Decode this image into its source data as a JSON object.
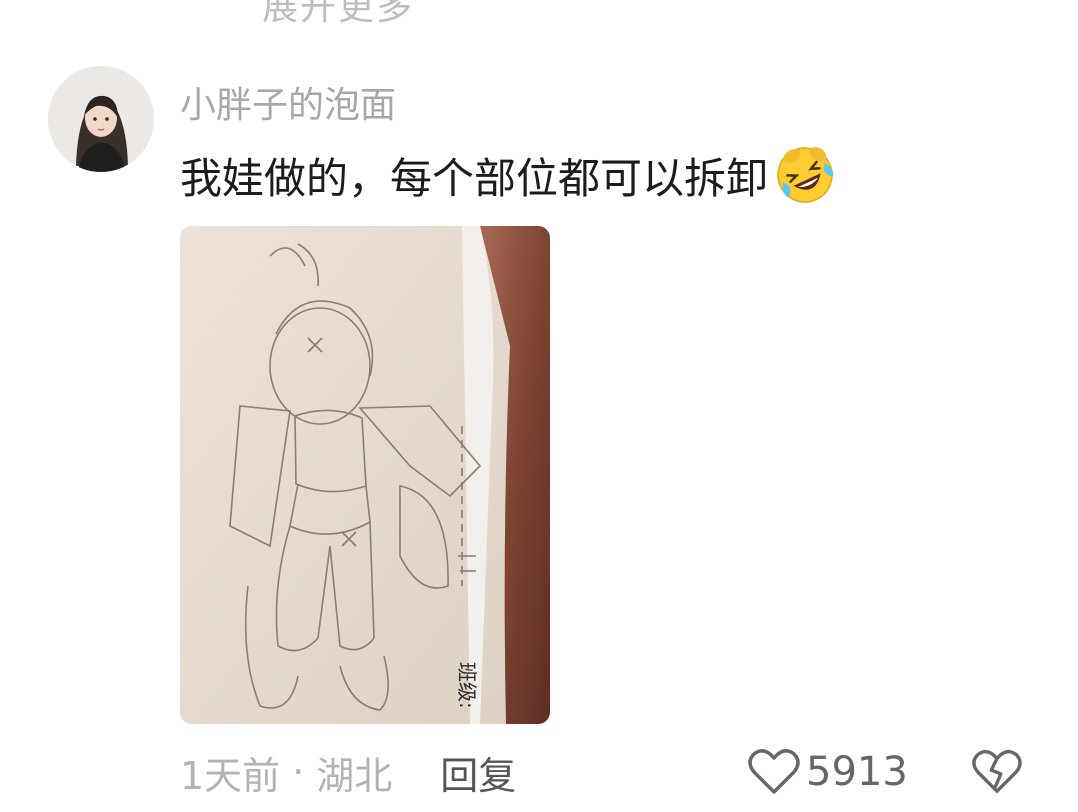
{
  "top_partial_text": "展开更多",
  "comment": {
    "username": "小胖子的泡面",
    "text": "我娃做的，每个部位都可以拆卸",
    "emoji": "rolling-on-floor-laughing-emoji",
    "image": {
      "alt": "paper cut-out doll drawing",
      "label_text": "班级:"
    },
    "time": "1天前",
    "separator": "·",
    "location": "湖北",
    "reply_label": "回复",
    "like_count": "5913"
  },
  "colors": {
    "username": "#a7a7a7",
    "comment_text": "#1c1c1c",
    "meta": "#b3b3b3",
    "reply": "#555555",
    "icon": "#666666"
  }
}
